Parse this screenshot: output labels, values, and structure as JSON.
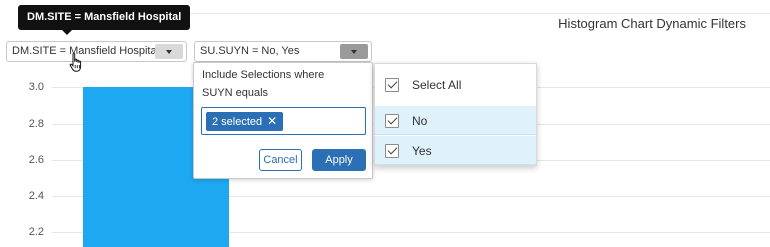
{
  "chart": {
    "title": "Histogram Chart Dynamic Filters",
    "y_ticks": [
      "3.0",
      "2.8",
      "2.6",
      "2.4",
      "2.2"
    ],
    "bar_color": "#1ea8f2"
  },
  "tooltip": {
    "text": "DM.SITE = Mansfield Hospital"
  },
  "filters": [
    {
      "label": "DM.SITE = Mansfield Hospital"
    },
    {
      "label": "SU.SUYN = No, Yes"
    }
  ],
  "filter_panel": {
    "line1": "Include Selections where",
    "line2": "SUYN equals",
    "chip_label": "2 selected",
    "chip_close": "✕",
    "cancel_label": "Cancel",
    "apply_label": "Apply"
  },
  "options": {
    "select_all": "Select All",
    "items": [
      "No",
      "Yes"
    ]
  },
  "colors": {
    "accent": "#2b6fb5",
    "selected_row": "#dff1fb"
  }
}
